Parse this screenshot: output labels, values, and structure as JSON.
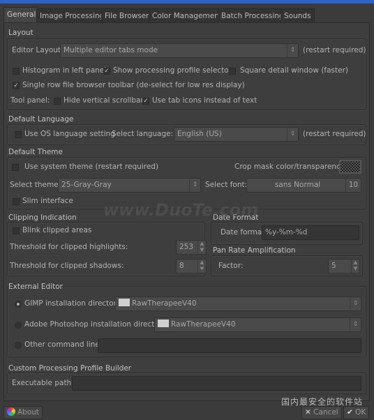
{
  "tabs": [
    "General",
    "Image Processing",
    "File Browser",
    "Color Management",
    "Batch Processing",
    "Sounds"
  ],
  "layout": {
    "title": "Layout",
    "editor_label": "Editor Layout:",
    "editor_value": "Multiple editor tabs mode",
    "restart": "(restart required)",
    "histogram": "Histogram in left panel",
    "show_profile": "Show processing profile selector",
    "square_detail": "Square detail window (faster)",
    "single_row": "Single row file browser toolbar (de-select for low res display)",
    "tool_panel": "Tool panel:",
    "hide_scrollbar": "Hide vertical scrollbar",
    "tab_icons": "Use tab icons instead of text",
    "checked": {
      "histogram": false,
      "show_profile": true,
      "square_detail": false,
      "single_row": true,
      "hide_scrollbar": false,
      "tab_icons": true
    }
  },
  "language": {
    "title": "Default Language",
    "use_os": "Use OS language setting",
    "select_label": "Select language:",
    "value": "English (US)",
    "restart": "(restart required)"
  },
  "theme": {
    "title": "Default Theme",
    "use_system": "Use system theme  (restart required)",
    "crop_mask": "Crop mask color/transparency:",
    "select_theme": "Select theme:",
    "theme_value": "25-Gray-Gray",
    "select_font": "Select font:",
    "font_value": "sans Normal",
    "font_size": "10",
    "slim": "Slim interface"
  },
  "clipping": {
    "title": "Clipping Indication",
    "blink": "Blink clipped areas",
    "highlights_label": "Threshold for clipped highlights:",
    "highlights": "253",
    "shadows_label": "Threshold for clipped shadows:",
    "shadows": "8"
  },
  "date": {
    "title": "Date Format",
    "label": "Date format:",
    "value": "%y-%m-%d"
  },
  "pan": {
    "title": "Pan Rate Amplification",
    "label": "Factor:",
    "value": "5"
  },
  "external": {
    "title": "External Editor",
    "gimp": "GIMP installation directory:",
    "gimp_value": "RawTherapeeV40",
    "ps": "Adobe Photoshop installation directory:",
    "ps_value": "RawTherapeeV40",
    "other": "Other command line:",
    "other_value": ""
  },
  "custom": {
    "title": "Custom Processing Profile Builder",
    "label": "Executable path:",
    "value": ""
  },
  "buttons": {
    "about": "About",
    "cancel": "Cancel",
    "ok": "OK"
  },
  "watermark": {
    "text": "www.DuoTe.com",
    "cn": "国内最安全的软件站"
  }
}
